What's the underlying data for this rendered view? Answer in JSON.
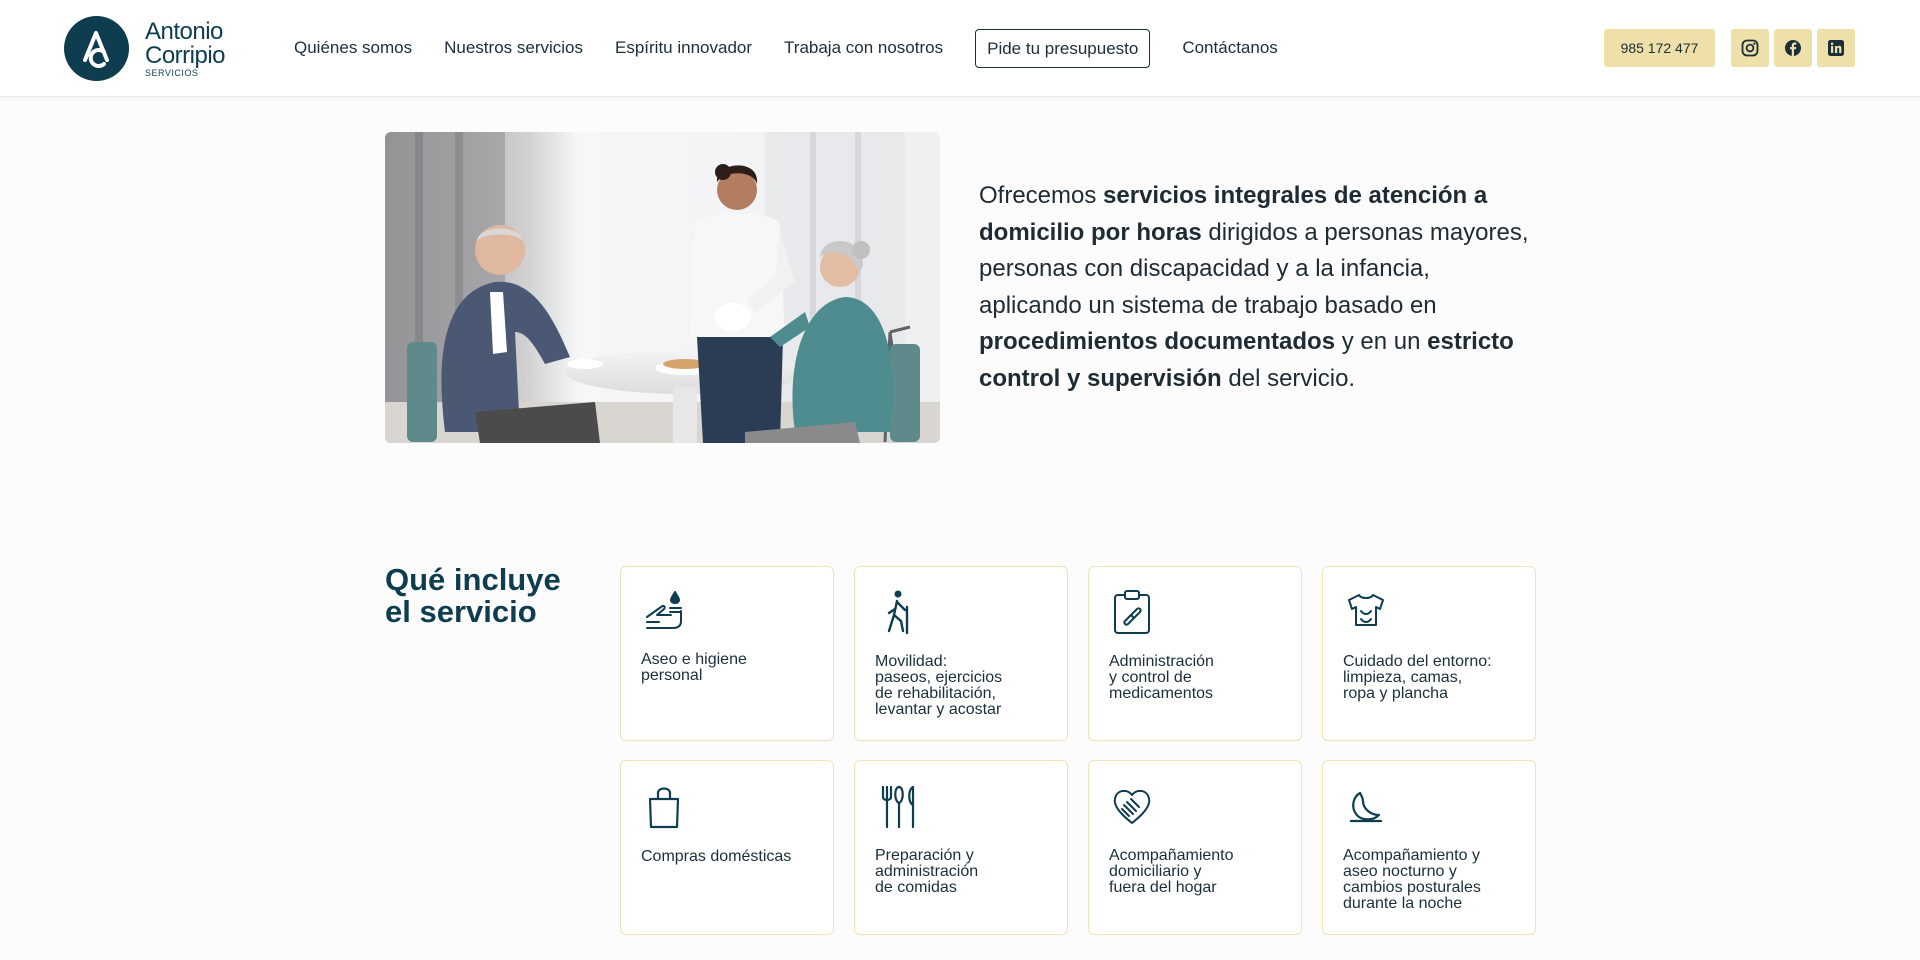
{
  "brand": {
    "name_line1": "Antonio",
    "name_line2": "Corripio",
    "sub": "SERVICIOS",
    "color": "#0e3d4f",
    "accent": "#efdfa8"
  },
  "nav": {
    "items": [
      "Quiénes somos",
      "Nuestros servicios",
      "Espíritu innovador",
      "Trabaja con nosotros"
    ],
    "cta": "Pide tu presupuesto",
    "contact": "Contáctanos"
  },
  "header": {
    "phone": "985 172 477",
    "social": [
      {
        "icon": "instagram-icon"
      },
      {
        "icon": "facebook-icon"
      },
      {
        "icon": "linkedin-icon"
      }
    ]
  },
  "hero": {
    "image": "caregiver-serving-tea-to-elderly-couple",
    "intro": [
      {
        "t": "Ofrecemos ",
        "b": false
      },
      {
        "t": "servicios integrales de atención a domicilio por horas",
        "b": true
      },
      {
        "t": " dirigidos a personas mayores, personas con discapacidad y a la infancia, aplicando un sistema de trabajo basado en ",
        "b": false
      },
      {
        "t": "procedimientos documentados",
        "b": true
      },
      {
        "t": " y en un ",
        "b": false
      },
      {
        "t": "estricto control y supervisión",
        "b": true
      },
      {
        "t": " del servicio.",
        "b": false
      }
    ]
  },
  "services": {
    "title": "Qué incluye el servicio",
    "items": [
      {
        "icon": "hand-wash-icon",
        "label": "Aseo e higiene\npersonal"
      },
      {
        "icon": "walking-person-icon",
        "label": "Movilidad:\npaseos, ejercicios\nde rehabilitación,\nlevantar y acostar"
      },
      {
        "icon": "clipboard-medication-icon",
        "label": "Administración\ny control de\nmedicamentos"
      },
      {
        "icon": "shirt-icon",
        "label": "Cuidado del entorno:\nlimpieza, camas,\nropa y plancha"
      },
      {
        "icon": "shopping-bag-icon",
        "label": "Compras domésticas"
      },
      {
        "icon": "cutlery-icon",
        "label": "Preparación y\nadministración\nde comidas"
      },
      {
        "icon": "handshake-icon",
        "label": "Acompañamiento\ndomiciliario y\nfuera del hogar"
      },
      {
        "icon": "moon-icon",
        "label": "Acompañamiento y\naseo nocturno y\ncambios posturales\ndurante la noche"
      }
    ]
  }
}
